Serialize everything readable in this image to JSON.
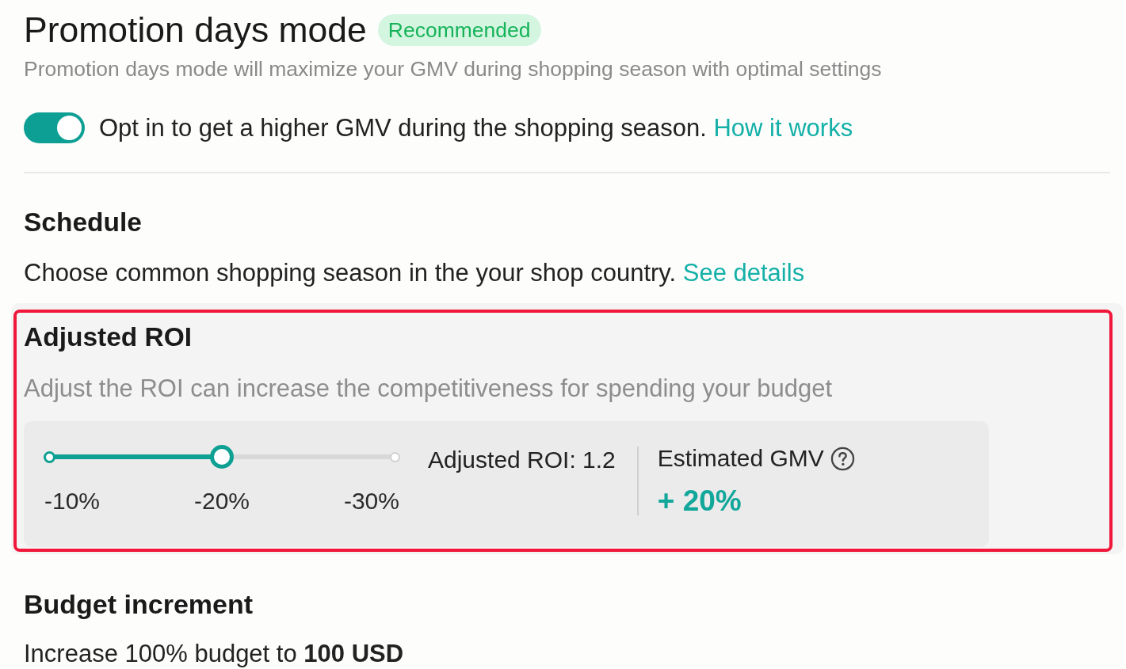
{
  "header": {
    "title": "Promotion days mode",
    "badge": "Recommended",
    "description": "Promotion days mode will maximize your GMV during shopping season with optimal settings"
  },
  "opt_in": {
    "on": true,
    "label": "Opt in to get a higher GMV during the shopping season.",
    "link": "How it works"
  },
  "schedule": {
    "title": "Schedule",
    "description": "Choose common shopping season in the your shop country.",
    "link": "See details"
  },
  "adjusted_roi": {
    "highlighted": true,
    "title": "Adjusted ROI",
    "description": "Adjust the ROI can increase the competitiveness for spending your budget",
    "slider": {
      "level": 0.5,
      "stops": [
        "-10%",
        "-20%",
        "-30%"
      ]
    },
    "reading": "Adjusted ROI: 1.2",
    "estimate": {
      "label": "Estimated GMV",
      "value": "+ 20%"
    }
  },
  "budget_increment": {
    "title": "Budget increment",
    "description": "Increase 100% budget to **100 USD**"
  }
}
